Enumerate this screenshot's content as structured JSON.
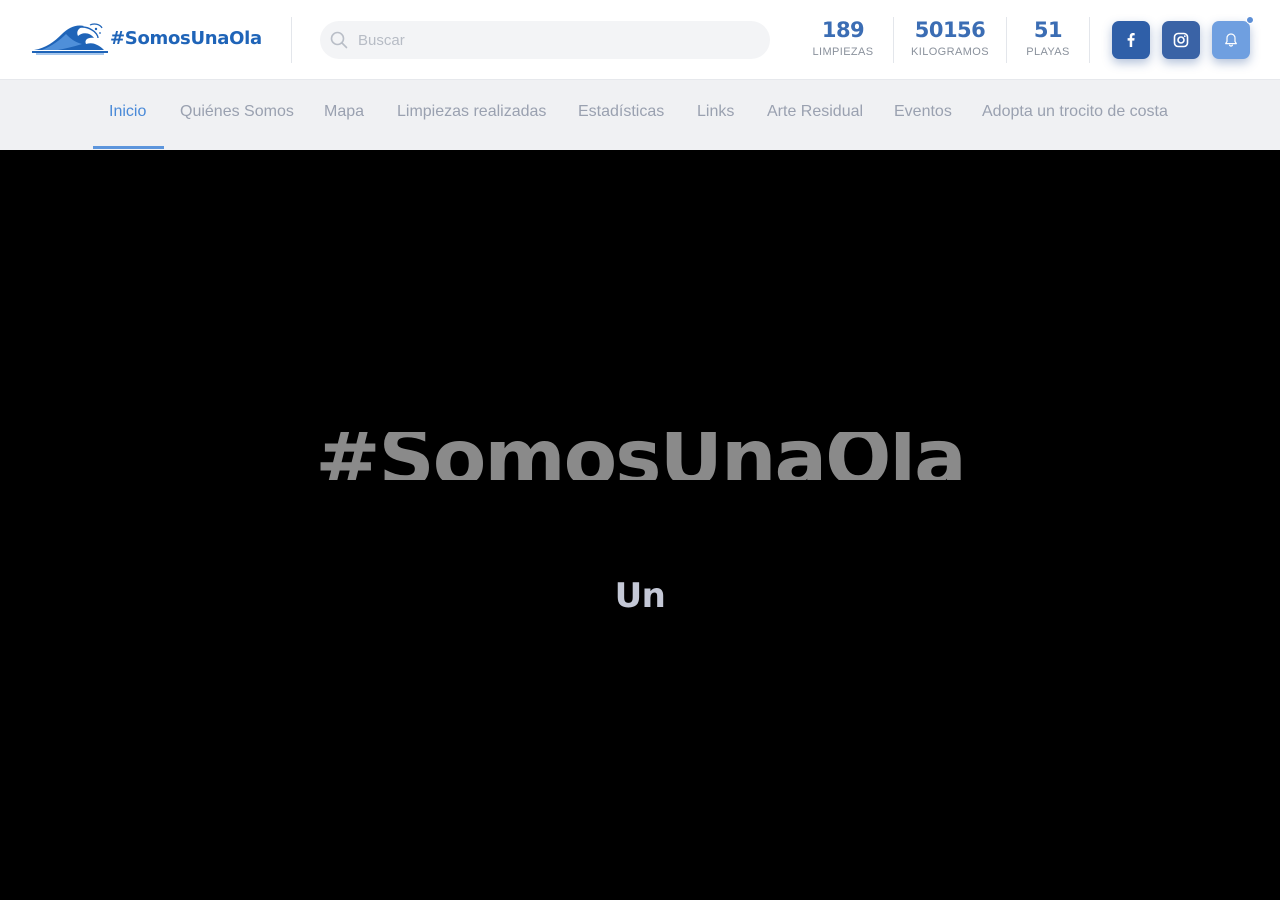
{
  "header": {
    "logo_text": "#SomosUnaOla",
    "search": {
      "placeholder": "Buscar",
      "value": ""
    },
    "stats": [
      {
        "value": "189",
        "label": "LIMPIEZAS"
      },
      {
        "value": "50156",
        "label": "KILOGRAMOS"
      },
      {
        "value": "51",
        "label": "PLAYAS"
      }
    ],
    "social": [
      {
        "icon": "facebook-icon"
      },
      {
        "icon": "instagram-icon"
      },
      {
        "icon": "bell-icon"
      }
    ],
    "colors": {
      "brand": "#1f64b8",
      "stat_number": "#3b6db4",
      "accent": "#4a8ad8"
    }
  },
  "nav": {
    "items": [
      {
        "label": "Inicio",
        "active": true
      },
      {
        "label": "Quiénes Somos"
      },
      {
        "label": "Mapa"
      },
      {
        "label": "Limpiezas realizadas"
      },
      {
        "label": "Estadísticas"
      },
      {
        "label": "Links"
      },
      {
        "label": "Arte Residual"
      },
      {
        "label": "Eventos"
      },
      {
        "label": "Adopta un trocito de costa"
      }
    ]
  },
  "hero": {
    "title": "#SomosUnaOla",
    "subtitle": "Un"
  }
}
